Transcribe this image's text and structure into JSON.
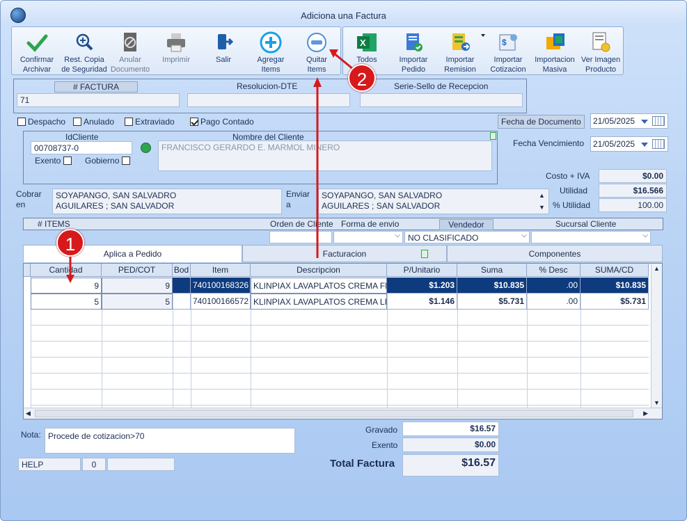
{
  "window": {
    "title": "Adiciona una Factura"
  },
  "toolbar": {
    "confirm": "Confirmar\nArchivar",
    "restore": "Rest. Copia\nde Seguridad",
    "cancel_doc": "Anular\nDocumento",
    "print": "Imprimir",
    "exit": "Salir",
    "add_items": "Agregar\nItems",
    "remove_items": "Quitar\nItems",
    "all": "Todos",
    "import_order": "Importar\nPedido",
    "import_remission": "Importar\nRemision",
    "import_quote": "Importar\nCotizacion",
    "import_bulk": "Importacion\nMasiva",
    "view_image": "Ver Imagen\nProducto"
  },
  "header": {
    "invoice_label": "# FACTURA",
    "invoice_value": "71",
    "resolution_label": "Resolucion-DTE",
    "resolution_value": "",
    "seal_label": "Serie-Sello de Recepcion",
    "seal_value": ""
  },
  "flags": {
    "despacho": "Despacho",
    "anulado": "Anulado",
    "extraviado": "Extraviado",
    "pago_contado": "Pago Contado"
  },
  "dates": {
    "doc_label": "Fecha de  Documento",
    "doc_value": "21/05/2025",
    "due_label": "Fecha Vencimiento",
    "due_value": "21/05/2025"
  },
  "client": {
    "id_label": "IdCliente",
    "id_value": "00708737-0",
    "name_label": "Nombre del Cliente",
    "name_value": "FRANCISCO GERARDO E. MARMOL MINERO",
    "exento": "Exento",
    "gobierno": "Gobierno"
  },
  "totals_right": {
    "cost_label": "Costo + IVA",
    "cost_value": "$0.00",
    "util_label": "Utilidad",
    "util_value": "$16.566",
    "putil_label": "% Utilidad",
    "putil_value": "100.00"
  },
  "address": {
    "cobrar_label": "Cobrar\nen",
    "cobrar_value": "SOYAPANGO, SAN SALVADRO\nAGUILARES ; SAN SALVADOR",
    "enviar_label": "Enviar\na",
    "enviar_value": "SOYAPANGO, SAN SALVADRO\nAGUILARES ; SAN SALVADOR"
  },
  "infobar": {
    "items_label": "# ITEMS",
    "orden_label": "Orden de Cliente",
    "forma_label": "Forma de envio",
    "vendedor_label": "Vendedor",
    "vendedor_value": "NO CLASIFICADO",
    "sucursal_label": "Sucursal Cliente"
  },
  "tabs": [
    "Aplica a Pedido",
    "Facturacion",
    "Componentes"
  ],
  "grid": {
    "columns": [
      "Cantidad",
      "PED/COT",
      "Bod",
      "Item",
      "Descripcion",
      "P/Unitario",
      "Suma",
      "% Desc",
      "SUMA/CD"
    ],
    "rows": [
      [
        "9",
        "9",
        "",
        "740100168326",
        "KLINPIAX LAVAPLATOS CREMA FF",
        "$1.203",
        "$10.835",
        ".00",
        "$10.835"
      ],
      [
        "5",
        "5",
        "",
        "740100166572",
        "KLINPIAX LAVAPLATOS CREMA LI",
        "$1.146",
        "$5.731",
        ".00",
        "$5.731"
      ]
    ]
  },
  "footer": {
    "nota_label": "Nota:",
    "nota_value": "Procede de cotizacion>70",
    "help": "HELP",
    "count": "0",
    "gravado_label": "Gravado",
    "gravado_value": "$16.57",
    "exento_label": "Exento",
    "exento_value": "$0.00",
    "total_label": "Total Factura",
    "total_value": "$16.57"
  },
  "annotations": {
    "badge1": "1",
    "badge2": "2"
  },
  "colors": {
    "accent": "#0e3b7e",
    "badge": "#d7191c"
  }
}
